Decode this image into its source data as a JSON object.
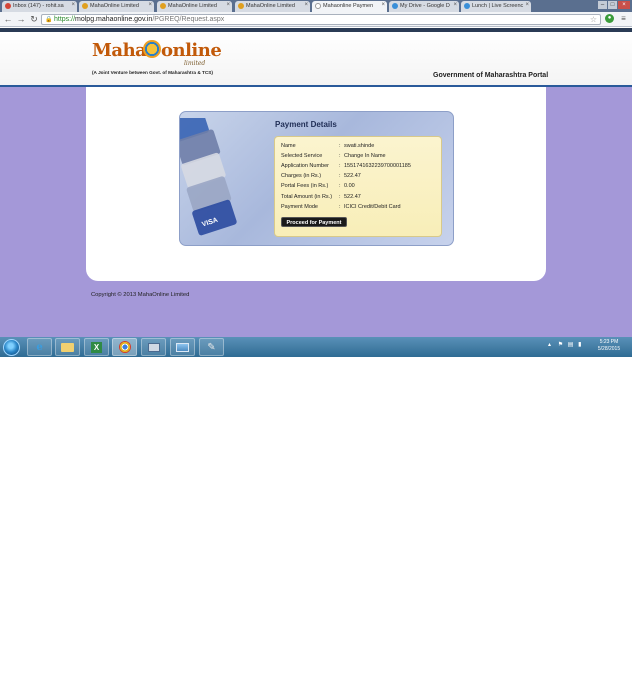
{
  "browser": {
    "tabs": [
      {
        "label": "Inbox (147) - rohit.sa",
        "favicon_color": "#d44638",
        "active": false
      },
      {
        "label": "MahaOnline Limited",
        "favicon_color": "#e0a020",
        "active": false
      },
      {
        "label": "MahaOnline Limited",
        "favicon_color": "#e0a020",
        "active": false
      },
      {
        "label": "MahaOnline Limited",
        "favicon_color": "#e0a020",
        "active": false
      },
      {
        "label": "Mahaonline Paymen",
        "favicon_color": "#ffffff",
        "active": true
      },
      {
        "label": "My Drive - Google D",
        "favicon_color": "#3a8fd8",
        "active": false
      },
      {
        "label": "Lunch | Live Screenc",
        "favicon_color": "#3a8fd8",
        "active": false
      }
    ],
    "url": {
      "scheme": "https://",
      "host": "molpg.mahaonline.gov.in",
      "path": "/PGREQ/Request.aspx"
    }
  },
  "header": {
    "logo_maha": "Maha",
    "logo_online": "online",
    "logo_limited": "limited",
    "tagline": "(A Joint Venture between Govt. of Maharashtra & TCS)",
    "portal_title": "Government of Maharashtra Portal"
  },
  "payment": {
    "title": "Payment Details",
    "rows": [
      {
        "label": "Name",
        "value": "swati.shinde"
      },
      {
        "label": "Selected Service",
        "value": "Change In Name"
      },
      {
        "label": "Application Number",
        "value": "15517416322397000011​85"
      },
      {
        "label": "Charges (in Rs.)",
        "value": "522.47"
      },
      {
        "label": "Portal Fees (in Rs.)",
        "value": "0.00"
      },
      {
        "label": "Total Amount (in Rs.)",
        "value": "522.47"
      },
      {
        "label": "Payment Mode",
        "value": "ICICI Credit/Debit Card"
      }
    ],
    "proceed_label": "Proceed for Payment"
  },
  "footer": {
    "copyright": "Copyright © 2013 MahaOnline Limited"
  },
  "taskbar": {
    "apps": [
      "internet-explorer",
      "file-explorer",
      "excel",
      "chrome",
      "remote-desktop",
      "photo-viewer",
      "tool"
    ],
    "clock_time": "5:23 PM",
    "clock_date": "5/28/2015"
  },
  "colors": {
    "page_background": "#a498d8",
    "header_line": "#2a5a9a",
    "accent_orange": "#c25a0a"
  }
}
